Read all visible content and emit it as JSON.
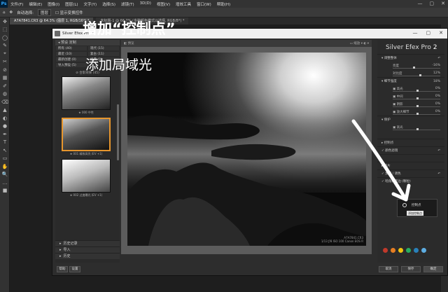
{
  "ps": {
    "logo": "Ps",
    "menu": [
      "文件(F)",
      "编辑(E)",
      "图像(I)",
      "图层(L)",
      "文字(Y)",
      "选择(S)",
      "滤镜(T)",
      "3D(D)",
      "视图(V)",
      "增效工具",
      "窗口(W)",
      "帮助(H)"
    ],
    "window_controls": [
      "—",
      "▢",
      "✕"
    ],
    "options": {
      "auto_select": "自动选择:",
      "layer_select": "图层",
      "show_transform": "显示变换控件"
    },
    "tabs": [
      "A7A7841.CR3 @ 64.3% (图层 1, RGB/16*) *",
      "未标题-1 @ 66.7% (多种颜色模式以选择, RGB/8*) *"
    ],
    "tools": [
      "✥",
      "⬚",
      "◯",
      "✎",
      "⌖",
      "✂",
      "⊘",
      "▦",
      "✐",
      "◍",
      "⌫",
      "▲",
      "◐",
      "●",
      "✒",
      "T",
      "↖",
      "▭",
      "✋",
      "🔍",
      "…",
      "■"
    ]
  },
  "sef": {
    "title": "Silver Efex Pro 2",
    "window_controls": [
      "—",
      "▢",
      "✕"
    ],
    "preset_header": "◂ 预设 定制",
    "categories": [
      {
        "label": "所有 (40)",
        "count": ""
      },
      {
        "label": "现代 (15)",
        "count": ""
      },
      {
        "label": "最近 (10)",
        "count": ""
      },
      {
        "label": "复古 (11)",
        "count": ""
      },
      {
        "label": "最新创建 (0)",
        "count": ""
      },
      {
        "label": "经典 (9)",
        "count": ""
      },
      {
        "label": "导入预设 (5)",
        "count": ""
      }
    ],
    "list_header": "⊘ 合影效果 (45)",
    "thumbs": [
      {
        "label": "★ 000 中性"
      },
      {
        "label": "★ 001 精致高亮 (EV +1)"
      },
      {
        "label": "★ 002 过度曝光 (EV +1)"
      }
    ],
    "left_bottom": [
      {
        "arrow": "▸",
        "label": "历史记录"
      },
      {
        "arrow": "▸",
        "label": "导入"
      },
      {
        "arrow": "▸",
        "label": "历史"
      }
    ],
    "toolbar": {
      "left": "◧ 预览",
      "right": "▭ 缩放 ▾   ◐ ▾"
    },
    "photo_info": [
      "A7A7841.CR3",
      "1/13 ƒ/8  ISO 100  Canon EOS R"
    ],
    "brand_name": "Silver Efex Pro",
    "brand_version": "2",
    "right_rows": [
      {
        "type": "row",
        "label": "▾ 调整整体",
        "value": "↶"
      },
      {
        "type": "sub",
        "label": "亮度",
        "value": "-16%",
        "knob": 0.42
      },
      {
        "type": "sub",
        "label": "对比度",
        "value": "12%",
        "knob": 0.56
      },
      {
        "type": "row",
        "label": "▾ 细节强度",
        "value": "18%"
      },
      {
        "type": "sub",
        "label": "▣ 高光",
        "value": "0%",
        "knob": 0.5
      },
      {
        "type": "sub",
        "label": "▣ 中间",
        "value": "0%",
        "knob": 0.5
      },
      {
        "type": "sub",
        "label": "▣ 阴影",
        "value": "0%",
        "knob": 0.5
      },
      {
        "type": "sub",
        "label": "▣ 放大细节",
        "value": "0%",
        "knob": 0.5
      },
      {
        "type": "row",
        "label": "▾ 保护",
        "value": ""
      },
      {
        "type": "sub",
        "label": "▣ 高光",
        "value": "",
        "knob": 0.5
      },
      {
        "type": "sub",
        "label": "",
        "value": ""
      },
      {
        "type": "row",
        "label": "▸ 控制点",
        "value": ""
      },
      {
        "type": "row",
        "label": "✓ 颜色滤镜",
        "value": "↶"
      },
      {
        "type": "row",
        "label": "",
        "value": ""
      },
      {
        "type": "row",
        "label": "▸ 胶片",
        "value": ""
      },
      {
        "type": "row",
        "label": "✓ 加照 / 调色",
        "value": "↶"
      },
      {
        "type": "row",
        "label": "✓ 暗角和黑边 (颗粒)",
        "value": ""
      }
    ],
    "control_point_popup": {
      "label": "控制点",
      "button": "添加控制点"
    },
    "color_dots": [
      "#c0392b",
      "#e67e22",
      "#f1c40f",
      "#27ae60",
      "#2980b9",
      "#5dade2"
    ],
    "bottom_buttons": {
      "help": "帮助",
      "settings": "设置",
      "cancel": "取消",
      "save": "保存",
      "ok": "确定"
    }
  },
  "captions": {
    "line1": "增加“控制点”",
    "line2": "添加局域光"
  }
}
